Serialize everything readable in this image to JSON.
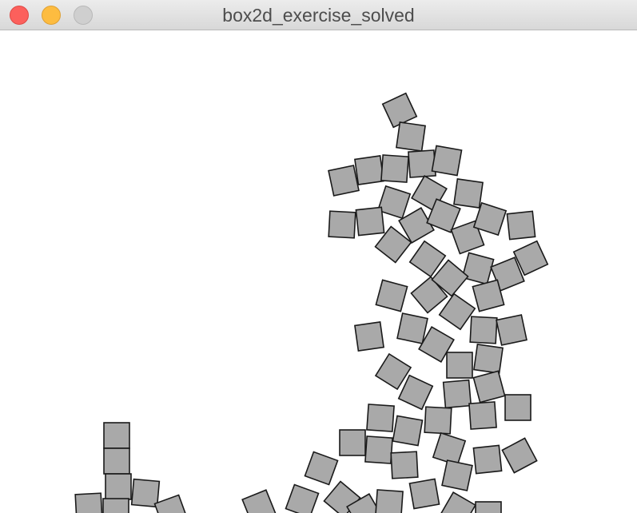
{
  "window": {
    "title": "box2d_exercise_solved"
  },
  "controls": {
    "close_icon": "close-icon",
    "minimize_icon": "minimize-icon",
    "zoom_icon": "zoom-icon"
  },
  "colors": {
    "box_fill": "#a9a9a9",
    "box_stroke": "#1a1a1a",
    "background": "#ffffff"
  }
}
